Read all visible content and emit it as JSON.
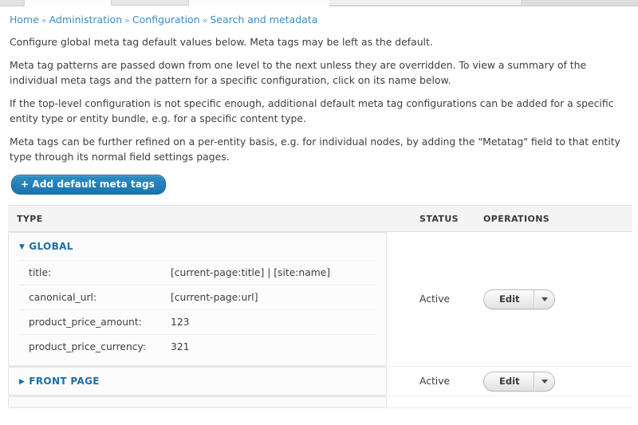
{
  "breadcrumb": {
    "separator": "»",
    "items": [
      "Home",
      "Administration",
      "Configuration",
      "Search and metadata"
    ]
  },
  "intro": {
    "p1": "Configure global meta tag default values below. Meta tags may be left as the default.",
    "p2": "Meta tag patterns are passed down from one level to the next unless they are overridden. To view a summary of the individual meta tags and the pattern for a specific configuration, click on its name below.",
    "p3": "If the top-level configuration is not specific enough, additional default meta tag configurations can be added for a specific entity type or entity bundle, e.g. for a specific content type.",
    "p4": "Meta tags can be further refined on a per-entity basis, e.g. for individual nodes, by adding the \"Metatag\" field to that entity type through its normal field settings pages."
  },
  "toolbar": {
    "add_label": "+ Add default meta tags"
  },
  "table": {
    "headers": {
      "type": "TYPE",
      "status": "STATUS",
      "operations": "OPERATIONS"
    },
    "rows": [
      {
        "name": "GLOBAL",
        "expanded": true,
        "triangle": "▼",
        "status": "Active",
        "edit_label": "Edit",
        "metatags": [
          {
            "key": "title:",
            "value": "[current-page:title] | [site:name]"
          },
          {
            "key": "canonical_url:",
            "value": "[current-page:url]"
          },
          {
            "key": "product_price_amount:",
            "value": "123"
          },
          {
            "key": "product_price_currency:",
            "value": "321"
          }
        ]
      },
      {
        "name": "FRONT PAGE",
        "expanded": false,
        "triangle": "▶",
        "status": "Active",
        "edit_label": "Edit",
        "metatags": []
      }
    ]
  },
  "colors": {
    "link": "#3c8dc5",
    "panel_heading": "#1d6ea8",
    "primary_button": "#1b73ad",
    "text": "#3d3d3d"
  }
}
